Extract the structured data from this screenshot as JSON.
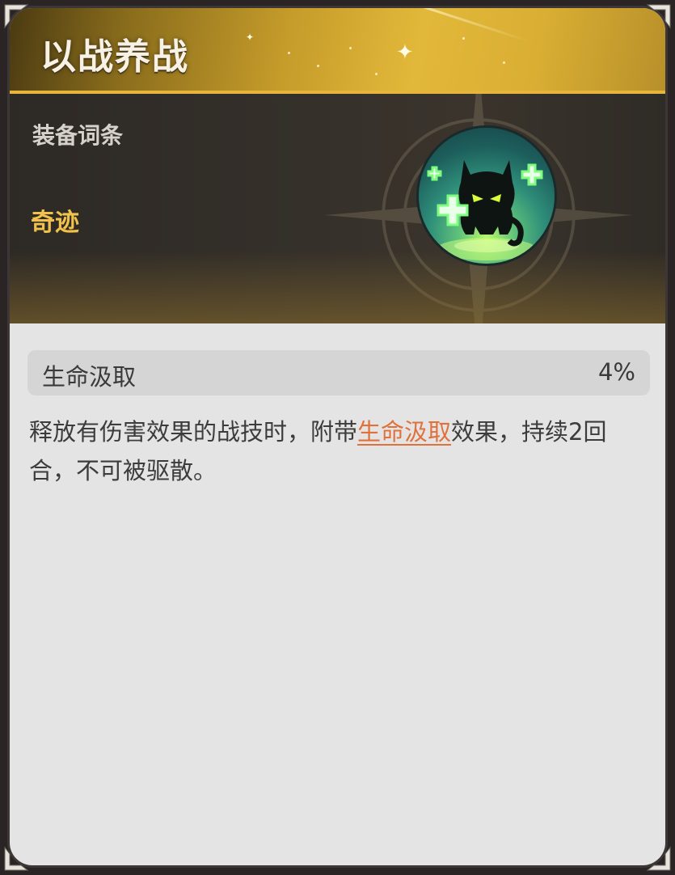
{
  "card": {
    "title": "以战养战",
    "category": "装备词条",
    "rarity": "奇迹",
    "icon": "healing-demon-icon",
    "stat": {
      "name": "生命汲取",
      "value": "4%"
    },
    "description": {
      "before": "释放有伤害效果的战技时，附带",
      "keyword": "生命汲取",
      "after": "效果，持续2回合，不可被驱散。"
    }
  },
  "colors": {
    "title_gold": "#e2b83a",
    "rarity": "#f0c24c",
    "keyword": "#e0713a",
    "body_bg": "#e4e4e4"
  }
}
